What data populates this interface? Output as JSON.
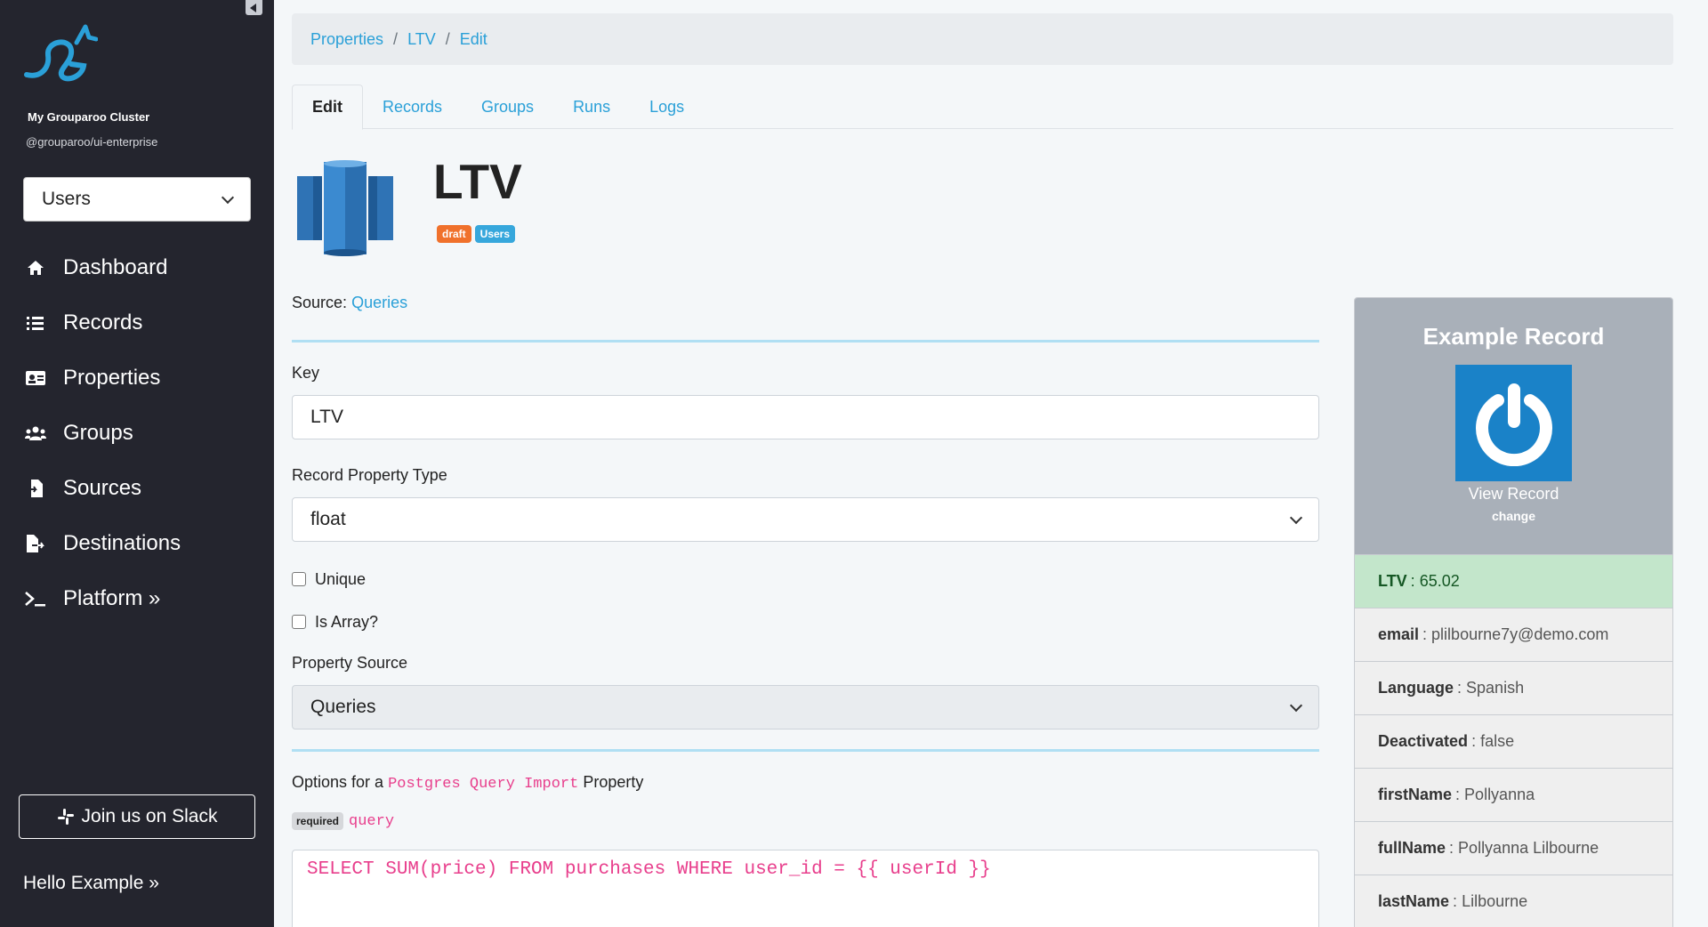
{
  "sidebar": {
    "cluster_name": "My Grouparoo Cluster",
    "cluster_sub": "@grouparoo/ui-enterprise",
    "model_select": "Users",
    "items": [
      {
        "label": "Dashboard",
        "icon": "home-icon"
      },
      {
        "label": "Records",
        "icon": "list-icon"
      },
      {
        "label": "Properties",
        "icon": "id-card-icon"
      },
      {
        "label": "Groups",
        "icon": "users-icon"
      },
      {
        "label": "Sources",
        "icon": "file-import-icon"
      },
      {
        "label": "Destinations",
        "icon": "file-export-icon"
      },
      {
        "label": "Platform »",
        "icon": "terminal-icon"
      }
    ],
    "slack_label": "Join us on Slack",
    "hello": "Hello Example »"
  },
  "breadcrumb": [
    "Properties",
    "LTV",
    "Edit"
  ],
  "tabs": [
    "Edit",
    "Records",
    "Groups",
    "Runs",
    "Logs"
  ],
  "property": {
    "title": "LTV",
    "badge_state": "draft",
    "badge_model": "Users",
    "source_label": "Source",
    "source_value": "Queries"
  },
  "form": {
    "key_label": "Key",
    "key_value": "LTV",
    "type_label": "Record Property Type",
    "type_value": "float",
    "unique_label": "Unique",
    "array_label": "Is Array?",
    "source_label": "Property Source",
    "source_value": "Queries",
    "options_prefix": "Options for a",
    "options_code": "Postgres Query Import",
    "options_suffix": "Property",
    "required_badge": "required",
    "query_label": "query",
    "query_value": "SELECT SUM(price) FROM purchases WHERE user_id = {{ userId }}"
  },
  "example_record": {
    "title": "Example Record",
    "view_label": "View Record",
    "change_label": "change",
    "rows": [
      {
        "key": "LTV",
        "value": "65.02"
      },
      {
        "key": "email",
        "value": "plilbourne7y@demo.com"
      },
      {
        "key": "Language",
        "value": "Spanish"
      },
      {
        "key": "Deactivated",
        "value": "false"
      },
      {
        "key": "firstName",
        "value": "Pollyanna"
      },
      {
        "key": "fullName",
        "value": "Pollyanna Lilbourne"
      },
      {
        "key": "lastName",
        "value": "Lilbourne"
      }
    ]
  },
  "colors": {
    "sidebar_bg": "#24252e",
    "link": "#2aa0d8",
    "draft_badge": "#f0712c",
    "model_badge": "#36a7dc",
    "highlight_row": "#c3e6cb"
  }
}
